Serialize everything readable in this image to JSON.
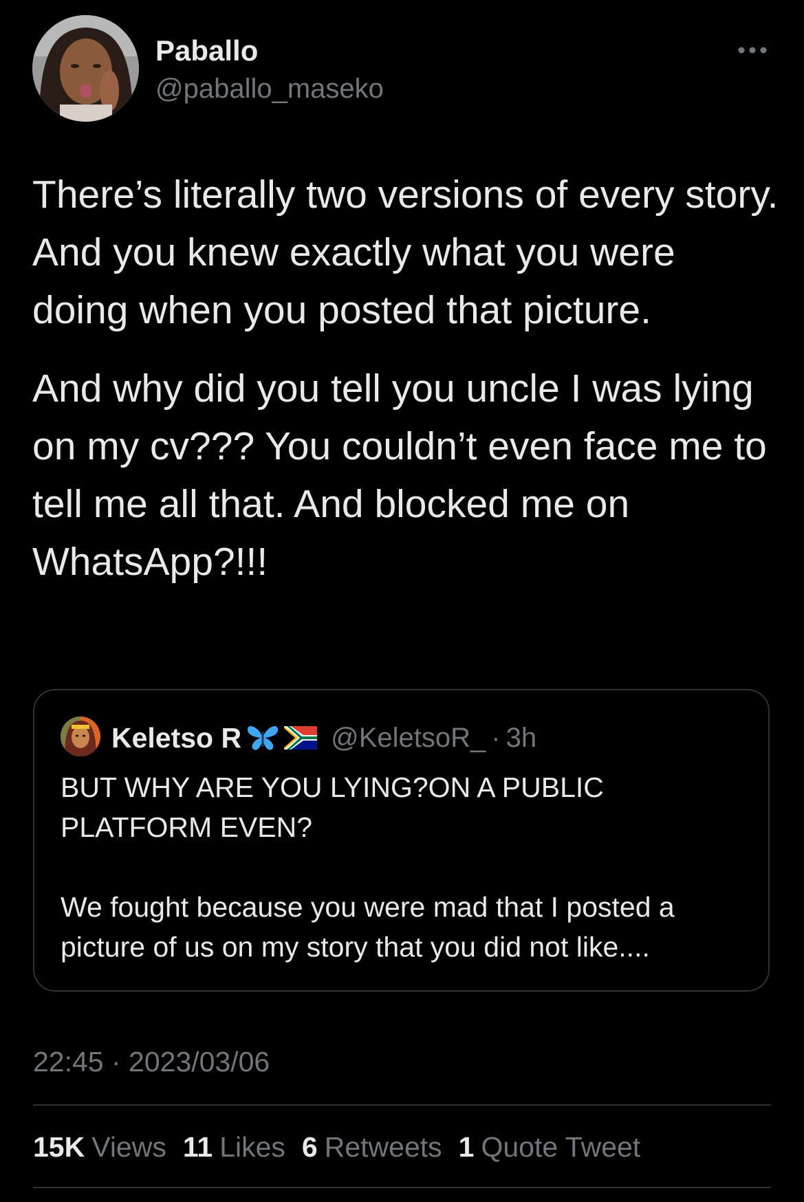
{
  "author": {
    "display_name": "Paballo",
    "handle": "@paballo_maseko",
    "avatar_icon": "profile-photo"
  },
  "more_icon": "ellipsis-icon",
  "tweet": {
    "paragraphs": [
      "There’s literally two versions of every story. And you knew exactly what you were doing when you posted that picture.",
      "And why did you tell you uncle I was lying on my cv??? You couldn’t even face me to tell me all that. And blocked me on WhatsApp?!!!"
    ]
  },
  "quote": {
    "display_name": "Keletso R",
    "emojis": [
      "butterfly-emoji",
      "south-africa-flag-emoji"
    ],
    "handle": "@KeletsoR_",
    "separator": "·",
    "time": "3h",
    "paragraphs": [
      "BUT WHY ARE YOU LYING?ON A PUBLIC PLATFORM EVEN?",
      "We fought because you were mad that I posted a picture of us on my story that you did not like...."
    ]
  },
  "timestamp": "22:45 · 2023/03/06",
  "stats": [
    {
      "count": "15K",
      "label": "Views"
    },
    {
      "count": "11",
      "label": "Likes"
    },
    {
      "count": "6",
      "label": "Retweets"
    },
    {
      "count": "1",
      "label": "Quote Tweet"
    }
  ],
  "colors": {
    "background": "#000000",
    "primary_text": "#e7e9ea",
    "secondary_text": "#71767b",
    "border": "#2f3336"
  }
}
